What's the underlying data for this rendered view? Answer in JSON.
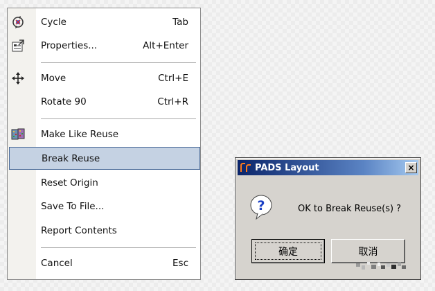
{
  "context_menu": {
    "items": [
      {
        "label": "Cycle",
        "shortcut": "Tab",
        "icon": "cycle-icon"
      },
      {
        "label": "Properties...",
        "shortcut": "Alt+Enter",
        "icon": "properties-icon"
      },
      {
        "label": "Move",
        "shortcut": "Ctrl+E",
        "icon": "move-icon"
      },
      {
        "label": "Rotate 90",
        "shortcut": "Ctrl+R",
        "icon": ""
      },
      {
        "label": "Make Like Reuse",
        "shortcut": "",
        "icon": "make-like-reuse-icon"
      },
      {
        "label": "Break Reuse",
        "shortcut": "",
        "icon": "",
        "selected": true
      },
      {
        "label": "Reset Origin",
        "shortcut": "",
        "icon": ""
      },
      {
        "label": "Save To File...",
        "shortcut": "",
        "icon": ""
      },
      {
        "label": "Report Contents",
        "shortcut": "",
        "icon": ""
      },
      {
        "label": "Cancel",
        "shortcut": "Esc",
        "icon": ""
      }
    ],
    "selection_color": "#c5d2e3"
  },
  "dialog": {
    "title": "PADS Layout",
    "close_label": "×",
    "message": "OK to Break Reuse(s) ?",
    "ok_label": "确定",
    "cancel_label": "取消",
    "title_color": "#0a246a",
    "icon": "question-icon"
  }
}
